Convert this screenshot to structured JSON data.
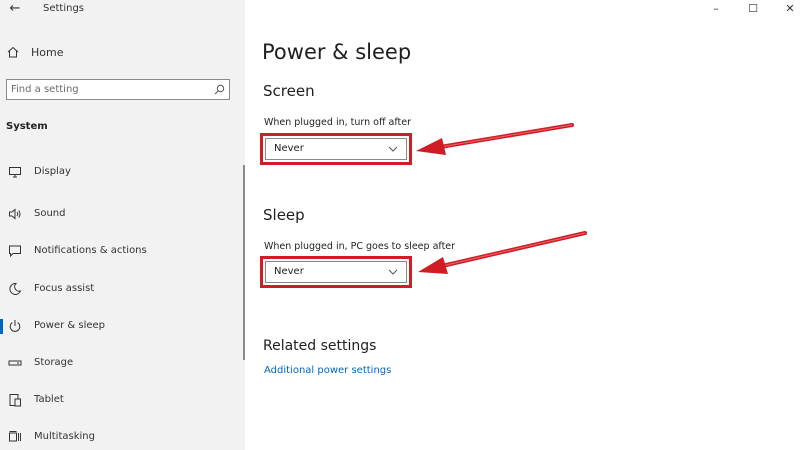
{
  "window": {
    "title": "Settings",
    "back_glyph": "←",
    "minimize_glyph": "–",
    "maximize_glyph": "☐",
    "close_glyph": "✕"
  },
  "sidebar": {
    "home_label": "Home",
    "search_placeholder": "Find a setting",
    "section_label": "System",
    "items": [
      {
        "label": "Display",
        "icon": "monitor-icon",
        "selected": false
      },
      {
        "label": "Sound",
        "icon": "speaker-icon",
        "selected": false
      },
      {
        "label": "Notifications & actions",
        "icon": "notifications-icon",
        "selected": false
      },
      {
        "label": "Focus assist",
        "icon": "moon-icon",
        "selected": false
      },
      {
        "label": "Power & sleep",
        "icon": "power-icon",
        "selected": true
      },
      {
        "label": "Storage",
        "icon": "storage-icon",
        "selected": false
      },
      {
        "label": "Tablet",
        "icon": "tablet-icon",
        "selected": false
      },
      {
        "label": "Multitasking",
        "icon": "multitasking-icon",
        "selected": false
      }
    ]
  },
  "main": {
    "title": "Power & sleep",
    "screen": {
      "heading": "Screen",
      "label": "When plugged in, turn off after",
      "value": "Never"
    },
    "sleep": {
      "heading": "Sleep",
      "label": "When plugged in, PC goes to sleep after",
      "value": "Never"
    },
    "related": {
      "heading": "Related settings",
      "link": "Additional power settings"
    }
  },
  "colors": {
    "accent": "#0067c0",
    "annotation": "#d01c24",
    "sidebar_bg": "#f2f2f2"
  }
}
